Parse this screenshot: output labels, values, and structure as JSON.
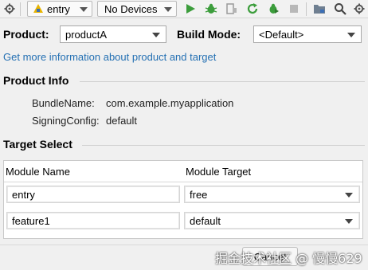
{
  "toolbar": {
    "module_combo": "entry",
    "device_combo": "No Devices"
  },
  "form": {
    "product_label": "Product:",
    "product_value": "productA",
    "build_mode_label": "Build Mode:",
    "build_mode_value": "<Default>",
    "more_info_link": "Get more information about product and target"
  },
  "product_info": {
    "title": "Product Info",
    "rows": [
      {
        "label": "BundleName:",
        "value": "com.example.myapplication"
      },
      {
        "label": "SigningConfig:",
        "value": "default"
      }
    ]
  },
  "target_select": {
    "title": "Target Select",
    "columns": [
      "Module Name",
      "Module Target"
    ],
    "rows": [
      {
        "module": "entry",
        "target": "free"
      },
      {
        "module": "feature1",
        "target": "default"
      }
    ]
  },
  "footer": {
    "cancel_label": "Cancel",
    "watermark": "掘金技术社区 @ 慢慢629"
  },
  "colors": {
    "link": "#2470b3",
    "run_green": "#3c9d3c",
    "android_green": "#3c9d3c"
  }
}
